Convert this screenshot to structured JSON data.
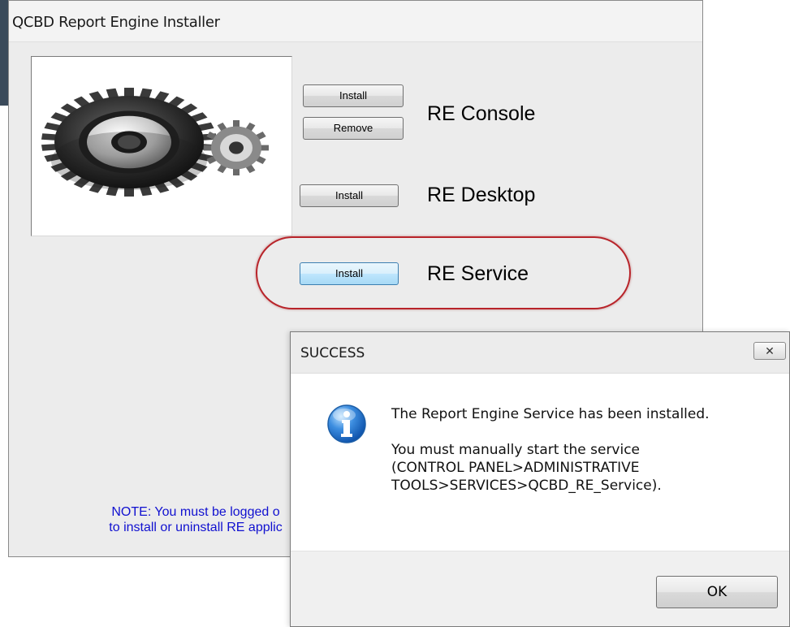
{
  "main_window": {
    "title": "QCBD Report Engine Installer",
    "apps": [
      {
        "label": "RE Console",
        "install_label": "Install",
        "remove_label": "Remove"
      },
      {
        "label": "RE Desktop",
        "install_label": "Install"
      },
      {
        "label": "RE Service",
        "install_label": "Install"
      }
    ],
    "note_line1": "NOTE: You must be logged o",
    "note_line2": "to install or uninstall RE applic",
    "highlight_color": "#b8242a",
    "note_color": "#1010d0"
  },
  "dialog": {
    "title": "SUCCESS",
    "close_glyph": "✕",
    "icon": "info-icon",
    "message_line1": "The Report Engine Service has been installed.",
    "message_line2": "You must manually start the service",
    "message_line3": "(CONTROL PANEL>ADMINISTRATIVE",
    "message_line4": "TOOLS>SERVICES>QCBD_RE_Service).",
    "ok_label": "OK"
  }
}
